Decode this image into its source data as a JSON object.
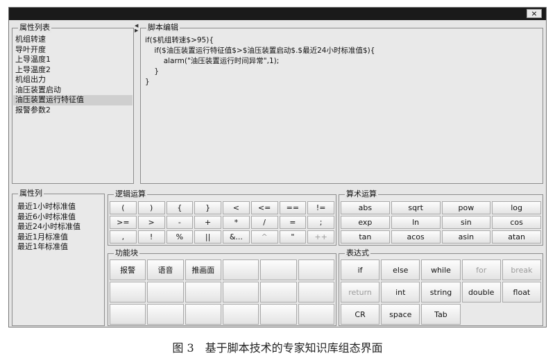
{
  "window": {
    "close_label": "×"
  },
  "attr_list": {
    "title": "属性列表",
    "items": [
      "机组转速",
      "导叶开度",
      "上导温度1",
      "上导温度2",
      "机组出力",
      "油压装置启动",
      "油压装置运行特征值",
      "报警参数2"
    ],
    "selected_index": 6
  },
  "script_editor": {
    "title": "脚本编辑",
    "lines": [
      "if($机组转速$>95){",
      "    if($油压装置运行特征值$>$油压装置启动$.$最近24小时标准值$){",
      "        alarm(\"油压装置运行时间异常\",1);",
      "    }",
      "}"
    ]
  },
  "attr_column": {
    "title": "属性列",
    "items": [
      "最近1小时标准值",
      "最近6小时标准值",
      "最近24小时标准值",
      "最近1月标准值",
      "最近1年标准值"
    ]
  },
  "logic_ops": {
    "title": "逻辑运算",
    "buttons": [
      "(",
      ")",
      "{",
      "}",
      "<",
      "<=",
      "==",
      "!=",
      ">=",
      ">",
      "-",
      "+",
      "*",
      "/",
      "=",
      ";",
      ",",
      "!",
      "%",
      "||",
      "&...",
      "^",
      "\"",
      "++"
    ],
    "disabled": [
      21,
      23
    ]
  },
  "arith_ops": {
    "title": "算术运算",
    "buttons": [
      "abs",
      "sqrt",
      "pow",
      "log",
      "exp",
      "ln",
      "sin",
      "cos",
      "tan",
      "acos",
      "asin",
      "atan"
    ]
  },
  "func_blocks": {
    "title": "功能块",
    "buttons": [
      "报警",
      "语音",
      "推画面",
      "",
      "",
      "",
      "",
      "",
      "",
      "",
      "",
      "",
      "",
      "",
      "",
      "",
      "",
      ""
    ]
  },
  "expressions": {
    "title": "表达式",
    "buttons": [
      "if",
      "else",
      "while",
      "for",
      "break",
      "return",
      "int",
      "string",
      "double",
      "float",
      "CR",
      "space",
      "Tab"
    ],
    "disabled": [
      3,
      4,
      5
    ]
  },
  "caption": "图 3　基于脚本技术的专家知识库组态界面"
}
